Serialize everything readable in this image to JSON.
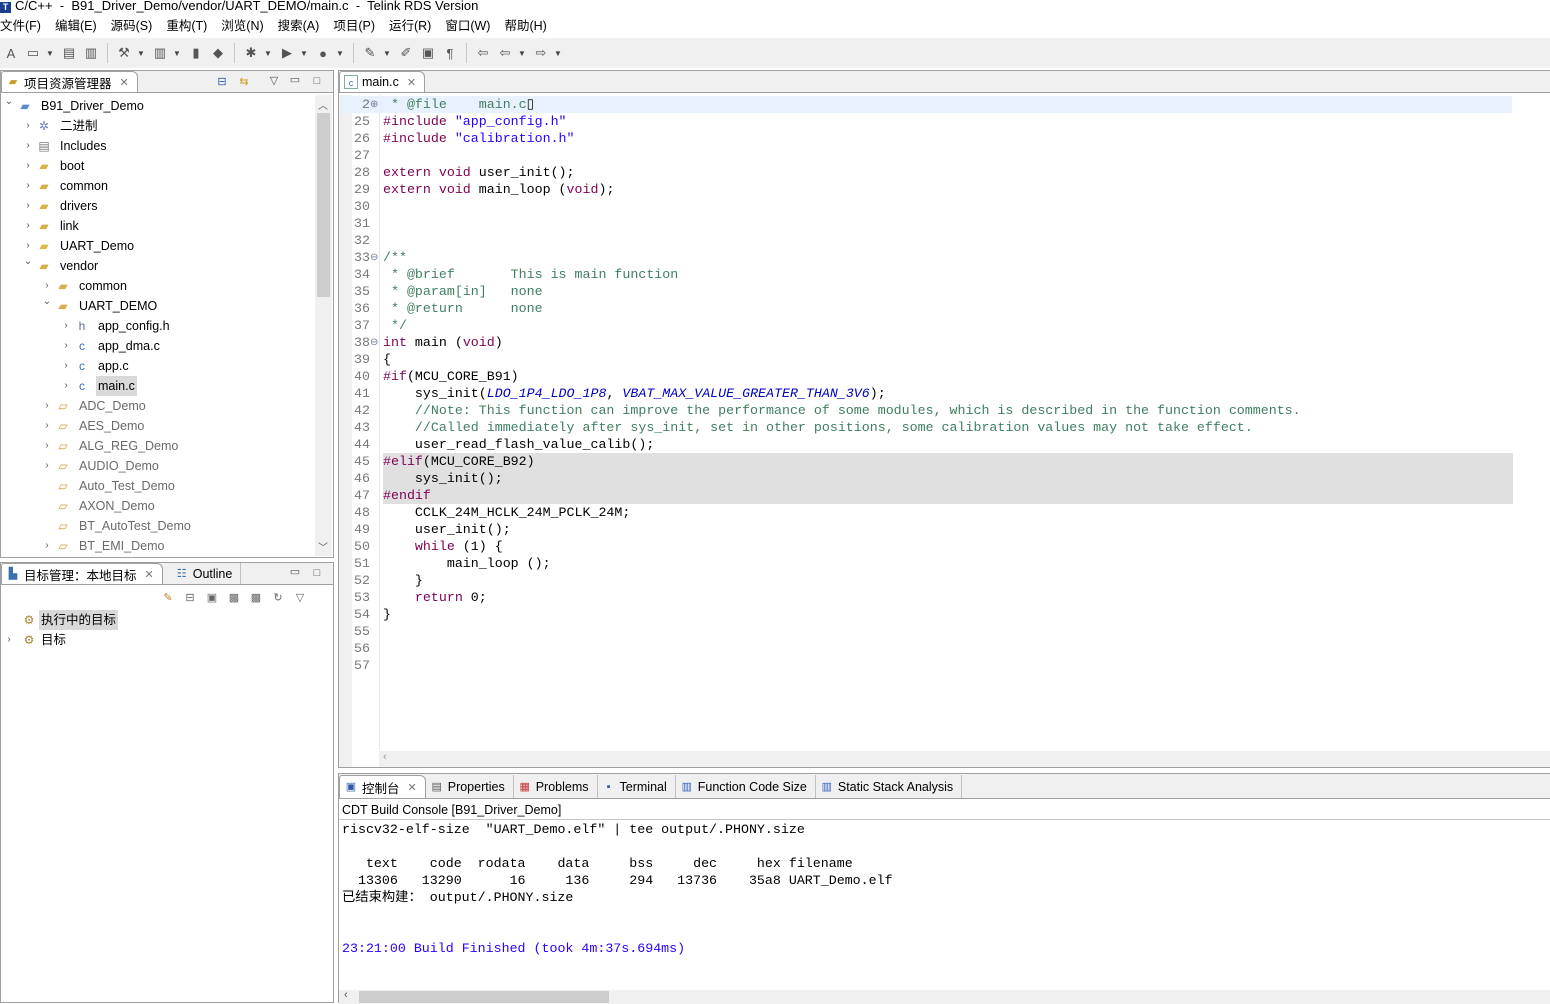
{
  "window": {
    "title": "C/C++  -  B91_Driver_Demo/vendor/UART_DEMO/main.c  -  Telink RDS Version",
    "logo": "T"
  },
  "menu": [
    "文件(F)",
    "编辑(E)",
    "源码(S)",
    "重构(T)",
    "浏览(N)",
    "搜索(A)",
    "项目(P)",
    "运行(R)",
    "窗口(W)",
    "帮助(H)"
  ],
  "toolbar": [
    {
      "icon": "new-c-project-icon",
      "glyph": "A"
    },
    {
      "icon": "new-file-icon",
      "glyph": "▭",
      "dropdown": true
    },
    {
      "icon": "save-icon",
      "glyph": "▤"
    },
    {
      "icon": "save-all-icon",
      "glyph": "▥"
    },
    {
      "sep": true
    },
    {
      "icon": "build-hammer-icon",
      "glyph": "⚒",
      "dropdown": true
    },
    {
      "icon": "chart-icon",
      "glyph": "▥",
      "dropdown": true
    },
    {
      "icon": "flash-icon",
      "glyph": "▮"
    },
    {
      "icon": "connect-icon",
      "glyph": "◆"
    },
    {
      "sep": true
    },
    {
      "icon": "debug-bug-icon",
      "glyph": "✱",
      "dropdown": true
    },
    {
      "icon": "run-icon",
      "glyph": "▶",
      "dropdown": true
    },
    {
      "icon": "run-config-icon",
      "glyph": "●",
      "dropdown": true
    },
    {
      "sep": true
    },
    {
      "icon": "external-tools-icon",
      "glyph": "✎",
      "dropdown": true
    },
    {
      "icon": "highlight-marker-icon",
      "glyph": "✐"
    },
    {
      "icon": "block-selection-icon",
      "glyph": "▣"
    },
    {
      "icon": "show-whitespace-icon",
      "glyph": "¶"
    },
    {
      "sep": true
    },
    {
      "icon": "last-edit-icon",
      "glyph": "⇦"
    },
    {
      "icon": "back-icon",
      "glyph": "⇦",
      "dropdown": true
    },
    {
      "icon": "forward-icon",
      "glyph": "⇨",
      "dropdown": true
    }
  ],
  "explorer": {
    "tab_label": "项目资源管理器",
    "tree": [
      {
        "label": "B91_Driver_Demo",
        "depth": 0,
        "chevron": "open",
        "icon": "project-open-icon"
      },
      {
        "label": "二进制",
        "depth": 1,
        "chevron": "closed",
        "icon": "binaries-icon"
      },
      {
        "label": "Includes",
        "depth": 1,
        "chevron": "closed",
        "icon": "includes-icon"
      },
      {
        "label": "boot",
        "depth": 1,
        "chevron": "closed",
        "icon": "source-folder-icon"
      },
      {
        "label": "common",
        "depth": 1,
        "chevron": "closed",
        "icon": "source-folder-icon"
      },
      {
        "label": "drivers",
        "depth": 1,
        "chevron": "closed",
        "icon": "source-folder-icon"
      },
      {
        "label": "link",
        "depth": 1,
        "chevron": "closed",
        "icon": "source-folder-icon"
      },
      {
        "label": "UART_Demo",
        "depth": 1,
        "chevron": "closed",
        "icon": "folder-icon"
      },
      {
        "label": "vendor",
        "depth": 1,
        "chevron": "open",
        "icon": "source-folder-icon"
      },
      {
        "label": "common",
        "depth": 2,
        "chevron": "closed",
        "icon": "source-folder-icon"
      },
      {
        "label": "UART_DEMO",
        "depth": 2,
        "chevron": "open",
        "icon": "source-folder-icon"
      },
      {
        "label": "app_config.h",
        "depth": 3,
        "chevron": "closed",
        "icon": "header-file-icon"
      },
      {
        "label": "app_dma.c",
        "depth": 3,
        "chevron": "closed",
        "icon": "c-file-icon"
      },
      {
        "label": "app.c",
        "depth": 3,
        "chevron": "closed",
        "icon": "c-file-icon"
      },
      {
        "label": "main.c",
        "depth": 3,
        "chevron": "closed",
        "icon": "c-file-icon",
        "selected": true
      },
      {
        "label": "ADC_Demo",
        "depth": 2,
        "chevron": "closed",
        "icon": "closed-project-icon",
        "closed": true
      },
      {
        "label": "AES_Demo",
        "depth": 2,
        "chevron": "closed",
        "icon": "closed-project-icon",
        "closed": true
      },
      {
        "label": "ALG_REG_Demo",
        "depth": 2,
        "chevron": "closed",
        "icon": "closed-project-icon",
        "closed": true
      },
      {
        "label": "AUDIO_Demo",
        "depth": 2,
        "chevron": "closed",
        "icon": "closed-project-icon",
        "closed": true
      },
      {
        "label": "Auto_Test_Demo",
        "depth": 2,
        "chevron": "none",
        "icon": "closed-project-icon",
        "closed": true
      },
      {
        "label": "AXON_Demo",
        "depth": 2,
        "chevron": "none",
        "icon": "closed-project-icon",
        "closed": true
      },
      {
        "label": "BT_AutoTest_Demo",
        "depth": 2,
        "chevron": "none",
        "icon": "closed-project-icon",
        "closed": true
      },
      {
        "label": "BT_EMI_Demo",
        "depth": 2,
        "chevron": "closed",
        "icon": "closed-project-icon",
        "closed": true
      }
    ]
  },
  "targets": {
    "tab_label": "目标管理：本地目标",
    "outline_label": "Outline",
    "items": [
      {
        "label": "执行中的目标",
        "chevron": "none",
        "selected": true
      },
      {
        "label": "目标",
        "chevron": "closed"
      }
    ]
  },
  "editor": {
    "tab_label": "main.c",
    "lines": [
      {
        "n": "2",
        "fold": "plus",
        "current": true,
        "tokens": [
          {
            "c": "cm",
            "t": " * @file    main.c"
          },
          {
            "c": "id",
            "t": "▯"
          }
        ]
      },
      {
        "n": "25",
        "tokens": [
          {
            "c": "pp",
            "t": "#include "
          },
          {
            "c": "str",
            "t": "\"app_config.h\""
          }
        ]
      },
      {
        "n": "26",
        "tokens": [
          {
            "c": "pp",
            "t": "#include "
          },
          {
            "c": "str",
            "t": "\"calibration.h\""
          }
        ]
      },
      {
        "n": "27",
        "tokens": []
      },
      {
        "n": "28",
        "tokens": [
          {
            "c": "kw",
            "t": "extern void "
          },
          {
            "c": "id",
            "t": "user_init();"
          }
        ]
      },
      {
        "n": "29",
        "tokens": [
          {
            "c": "kw",
            "t": "extern void "
          },
          {
            "c": "id",
            "t": "main_loop ("
          },
          {
            "c": "kw",
            "t": "void"
          },
          {
            "c": "id",
            "t": ");"
          }
        ]
      },
      {
        "n": "30",
        "tokens": []
      },
      {
        "n": "31",
        "tokens": []
      },
      {
        "n": "32",
        "tokens": []
      },
      {
        "n": "33",
        "fold": "minus",
        "tokens": [
          {
            "c": "cm",
            "t": "/**"
          }
        ]
      },
      {
        "n": "34",
        "tokens": [
          {
            "c": "cm",
            "t": " * @brief       This is main function"
          }
        ]
      },
      {
        "n": "35",
        "tokens": [
          {
            "c": "cm",
            "t": " * @param[in]   none"
          }
        ]
      },
      {
        "n": "36",
        "tokens": [
          {
            "c": "cm",
            "t": " * @return      none"
          }
        ]
      },
      {
        "n": "37",
        "tokens": [
          {
            "c": "cm",
            "t": " */"
          }
        ]
      },
      {
        "n": "38",
        "fold": "minus",
        "tokens": [
          {
            "c": "kw",
            "t": "int "
          },
          {
            "c": "id",
            "t": "main ("
          },
          {
            "c": "kw",
            "t": "void"
          },
          {
            "c": "id",
            "t": ")"
          }
        ]
      },
      {
        "n": "39",
        "tokens": [
          {
            "c": "id",
            "t": "{"
          }
        ]
      },
      {
        "n": "40",
        "tokens": [
          {
            "c": "pp",
            "t": "#if"
          },
          {
            "c": "id",
            "t": "(MCU_CORE_B91)"
          }
        ]
      },
      {
        "n": "41",
        "tokens": [
          {
            "c": "id",
            "t": "    sys_init("
          },
          {
            "c": "mac",
            "t": "LDO_1P4_LDO_1P8"
          },
          {
            "c": "id",
            "t": ", "
          },
          {
            "c": "mac",
            "t": "VBAT_MAX_VALUE_GREATER_THAN_3V6"
          },
          {
            "c": "id",
            "t": ");"
          }
        ]
      },
      {
        "n": "42",
        "tokens": [
          {
            "c": "cm",
            "t": "    //Note: This function can improve the performance of some modules, which is described in the function comments."
          }
        ]
      },
      {
        "n": "43",
        "tokens": [
          {
            "c": "cm",
            "t": "    //Called immediately after sys_init, set in other positions, some calibration values may not take effect."
          }
        ]
      },
      {
        "n": "44",
        "tokens": [
          {
            "c": "id",
            "t": "    user_read_flash_value_calib();"
          }
        ]
      },
      {
        "n": "45",
        "inactive": true,
        "tokens": [
          {
            "c": "pp",
            "t": "#elif"
          },
          {
            "c": "id",
            "t": "(MCU_CORE_B92)"
          }
        ]
      },
      {
        "n": "46",
        "inactive": true,
        "tokens": [
          {
            "c": "id",
            "t": "    sys_init();"
          }
        ]
      },
      {
        "n": "47",
        "inactive": true,
        "tokens": [
          {
            "c": "pp",
            "t": "#endif"
          }
        ]
      },
      {
        "n": "48",
        "tokens": [
          {
            "c": "id",
            "t": "    CCLK_24M_HCLK_24M_PCLK_24M;"
          }
        ]
      },
      {
        "n": "49",
        "tokens": [
          {
            "c": "id",
            "t": "    user_init();"
          }
        ]
      },
      {
        "n": "50",
        "tokens": [
          {
            "c": "kw",
            "t": "    while "
          },
          {
            "c": "id",
            "t": "(1) {"
          }
        ]
      },
      {
        "n": "51",
        "tokens": [
          {
            "c": "id",
            "t": "        main_loop ();"
          }
        ]
      },
      {
        "n": "52",
        "tokens": [
          {
            "c": "id",
            "t": "    }"
          }
        ]
      },
      {
        "n": "53",
        "tokens": [
          {
            "c": "kw",
            "t": "    return "
          },
          {
            "c": "id",
            "t": "0;"
          }
        ]
      },
      {
        "n": "54",
        "tokens": [
          {
            "c": "id",
            "t": "}"
          }
        ]
      },
      {
        "n": "55",
        "tokens": []
      },
      {
        "n": "56",
        "tokens": []
      },
      {
        "n": "57",
        "tokens": []
      }
    ]
  },
  "bottom": {
    "tabs": [
      {
        "label": "控制台",
        "icon": "console-icon",
        "active": true
      },
      {
        "label": "Properties",
        "icon": "properties-icon"
      },
      {
        "label": "Problems",
        "icon": "problems-icon"
      },
      {
        "label": "Terminal",
        "icon": "terminal-icon"
      },
      {
        "label": "Function Code Size",
        "icon": "bar-chart-icon"
      },
      {
        "label": "Static Stack Analysis",
        "icon": "bar-chart-icon"
      }
    ],
    "console_title": "CDT Build Console [B91_Driver_Demo]",
    "lines": [
      {
        "t": "riscv32-elf-size  \"UART_Demo.elf\" | tee output/.PHONY.size"
      },
      {
        "t": ""
      },
      {
        "t": "   text    code  rodata    data     bss     dec     hex filename"
      },
      {
        "t": "  13306   13290      16     136     294   13736    35a8 UART_Demo.elf"
      },
      {
        "t": "已结束构建： output/.PHONY.size"
      },
      {
        "t": ""
      },
      {
        "t": ""
      },
      {
        "t": "23:21:00 Build Finished (took 4m:37s.694ms)",
        "color": "#2a00ff"
      }
    ]
  },
  "colors": {
    "keyword": "#7f0055",
    "string": "#2a00ff",
    "comment": "#3f7f5f",
    "macro": "#0000c0",
    "inactive_bg": "#e0e0e0"
  }
}
